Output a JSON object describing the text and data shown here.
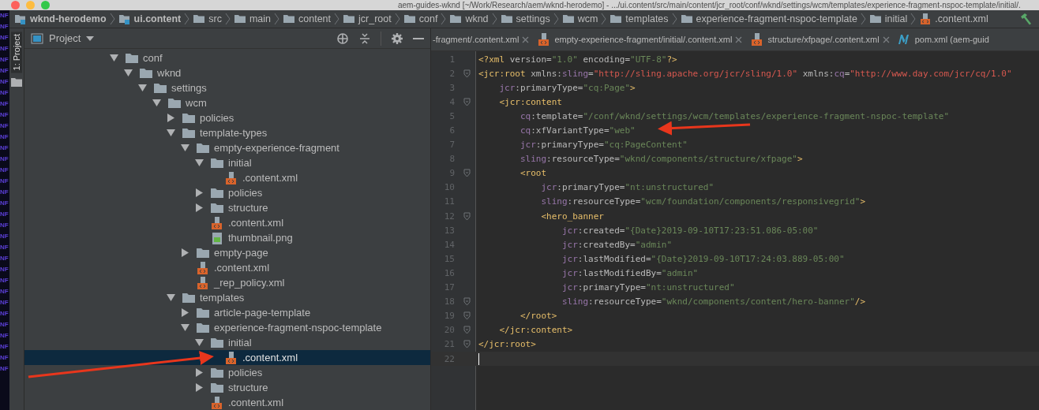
{
  "window": {
    "title": "aem-guides-wknd [~/Work/Research/aem/wknd-herodemo] - .../ui.content/src/main/content/jcr_root/conf/wknd/settings/wcm/templates/experience-fragment-nspoc-template/initial/."
  },
  "background_text": [
    "NF",
    "NF",
    "NF",
    "NF",
    "NF",
    "NF",
    "NF",
    "NF",
    "NF",
    "NF",
    "NF",
    "NF",
    "NF",
    "NF",
    "NF",
    "NF",
    "NF",
    "NF",
    "NF",
    "NF",
    "NF",
    "NF",
    "NF",
    "NF",
    "NF",
    "NF",
    "NF",
    "NF",
    "NF",
    "NF",
    "NF",
    "NF",
    "NF"
  ],
  "breadcrumbs": [
    {
      "label": "wknd-herodemo",
      "kind": "module"
    },
    {
      "label": "ui.content",
      "kind": "module"
    },
    {
      "label": "src",
      "kind": "folder"
    },
    {
      "label": "main",
      "kind": "folder"
    },
    {
      "label": "content",
      "kind": "folder"
    },
    {
      "label": "jcr_root",
      "kind": "folder"
    },
    {
      "label": "conf",
      "kind": "folder"
    },
    {
      "label": "wknd",
      "kind": "folder"
    },
    {
      "label": "settings",
      "kind": "folder"
    },
    {
      "label": "wcm",
      "kind": "folder"
    },
    {
      "label": "templates",
      "kind": "folder"
    },
    {
      "label": "experience-fragment-nspoc-template",
      "kind": "folder"
    },
    {
      "label": "initial",
      "kind": "folder"
    },
    {
      "label": ".content.xml",
      "kind": "xml"
    }
  ],
  "tool_stripe": {
    "label": "1: Project"
  },
  "project_panel": {
    "title": "Project"
  },
  "tree": [
    {
      "label": "conf",
      "kind": "folder",
      "expanded": true,
      "selected": false,
      "children": [
        {
          "label": "wknd",
          "kind": "folder",
          "expanded": true,
          "selected": false,
          "children": [
            {
              "label": "settings",
              "kind": "folder",
              "expanded": true,
              "selected": false,
              "children": [
                {
                  "label": "wcm",
                  "kind": "folder",
                  "expanded": true,
                  "selected": false,
                  "children": [
                    {
                      "label": "policies",
                      "kind": "folder",
                      "expanded": false,
                      "selected": false
                    },
                    {
                      "label": "template-types",
                      "kind": "folder",
                      "expanded": true,
                      "selected": false,
                      "children": [
                        {
                          "label": "empty-experience-fragment",
                          "kind": "folder",
                          "expanded": true,
                          "selected": false,
                          "children": [
                            {
                              "label": "initial",
                              "kind": "folder",
                              "expanded": true,
                              "selected": false,
                              "children": [
                                {
                                  "label": ".content.xml",
                                  "kind": "xml",
                                  "selected": false
                                }
                              ]
                            },
                            {
                              "label": "policies",
                              "kind": "folder",
                              "expanded": false,
                              "selected": false
                            },
                            {
                              "label": "structure",
                              "kind": "folder",
                              "expanded": false,
                              "selected": false
                            },
                            {
                              "label": ".content.xml",
                              "kind": "xml",
                              "selected": false
                            },
                            {
                              "label": "thumbnail.png",
                              "kind": "image",
                              "selected": false
                            }
                          ]
                        },
                        {
                          "label": "empty-page",
                          "kind": "folder",
                          "expanded": false,
                          "selected": false
                        },
                        {
                          "label": ".content.xml",
                          "kind": "xml",
                          "selected": false
                        },
                        {
                          "label": "_rep_policy.xml",
                          "kind": "xml",
                          "selected": false
                        }
                      ]
                    },
                    {
                      "label": "templates",
                      "kind": "folder",
                      "expanded": true,
                      "selected": false,
                      "children": [
                        {
                          "label": "article-page-template",
                          "kind": "folder",
                          "expanded": false,
                          "selected": false
                        },
                        {
                          "label": "experience-fragment-nspoc-template",
                          "kind": "folder",
                          "expanded": true,
                          "selected": false,
                          "children": [
                            {
                              "label": "initial",
                              "kind": "folder",
                              "expanded": true,
                              "selected": false,
                              "children": [
                                {
                                  "label": ".content.xml",
                                  "kind": "xml",
                                  "selected": true
                                }
                              ]
                            },
                            {
                              "label": "policies",
                              "kind": "folder",
                              "expanded": false,
                              "selected": false
                            },
                            {
                              "label": "structure",
                              "kind": "folder",
                              "expanded": false,
                              "selected": false
                            },
                            {
                              "label": ".content.xml",
                              "kind": "xml",
                              "selected": false
                            }
                          ]
                        }
                      ]
                    }
                  ]
                }
              ]
            }
          ]
        }
      ]
    }
  ],
  "tabs": [
    {
      "label": "-fragment/.content.xml",
      "kind": "none",
      "selected": false
    },
    {
      "label": "empty-experience-fragment/initial/.content.xml",
      "kind": "xml",
      "selected": false
    },
    {
      "label": "structure/xfpage/.content.xml",
      "kind": "xml",
      "selected": false
    },
    {
      "label": "pom.xml (aem-guid",
      "kind": "maven",
      "selected": false
    }
  ],
  "editor": {
    "lines": [
      {
        "number": "1",
        "fold": false,
        "current": false,
        "segments": [
          {
            "text": "<?xml ",
            "kind": "tag"
          },
          {
            "text": "version=",
            "kind": "attr"
          },
          {
            "text": "\"1.0\"",
            "kind": "str"
          },
          {
            "text": " encoding=",
            "kind": "attr"
          },
          {
            "text": "\"UTF-8\"",
            "kind": "str"
          },
          {
            "text": "?>",
            "kind": "tag"
          }
        ]
      },
      {
        "number": "2",
        "fold": true,
        "current": false,
        "segments": [
          {
            "text": "<jcr:root ",
            "kind": "tag"
          },
          {
            "text": "xmlns:",
            "kind": "attr"
          },
          {
            "text": "sling",
            "kind": "ns"
          },
          {
            "text": "=",
            "kind": "attr"
          },
          {
            "text": "\"http://sling.apache.org/jcr/sling/1.0\"",
            "kind": "url"
          },
          {
            "text": " xmlns:",
            "kind": "attr"
          },
          {
            "text": "cq",
            "kind": "ns"
          },
          {
            "text": "=",
            "kind": "attr"
          },
          {
            "text": "\"http://www.day.com/jcr/cq/1.0\"",
            "kind": "url"
          }
        ]
      },
      {
        "number": "3",
        "fold": false,
        "current": false,
        "segments": [
          {
            "text": "    jcr",
            "kind": "ns"
          },
          {
            "text": ":primaryType=",
            "kind": "attr"
          },
          {
            "text": "\"cq:Page\"",
            "kind": "str"
          },
          {
            "text": ">",
            "kind": "tag"
          }
        ]
      },
      {
        "number": "4",
        "fold": true,
        "current": false,
        "segments": [
          {
            "text": "    <jcr:content",
            "kind": "tag"
          }
        ]
      },
      {
        "number": "5",
        "fold": false,
        "current": false,
        "segments": [
          {
            "text": "        cq",
            "kind": "ns"
          },
          {
            "text": ":template=",
            "kind": "attr"
          },
          {
            "text": "\"/conf/wknd/settings/wcm/templates/experience-fragment-nspoc-template\"",
            "kind": "str"
          }
        ]
      },
      {
        "number": "6",
        "fold": false,
        "current": false,
        "segments": [
          {
            "text": "        cq",
            "kind": "ns"
          },
          {
            "text": ":xfVariantType=",
            "kind": "attr"
          },
          {
            "text": "\"web\"",
            "kind": "str"
          }
        ]
      },
      {
        "number": "7",
        "fold": false,
        "current": false,
        "segments": [
          {
            "text": "        jcr",
            "kind": "ns"
          },
          {
            "text": ":primaryType=",
            "kind": "attr"
          },
          {
            "text": "\"cq:PageContent\"",
            "kind": "str"
          }
        ]
      },
      {
        "number": "8",
        "fold": false,
        "current": false,
        "segments": [
          {
            "text": "        sling",
            "kind": "ns"
          },
          {
            "text": ":resourceType=",
            "kind": "attr"
          },
          {
            "text": "\"wknd/components/structure/xfpage\"",
            "kind": "str"
          },
          {
            "text": ">",
            "kind": "tag"
          }
        ]
      },
      {
        "number": "9",
        "fold": true,
        "current": false,
        "segments": [
          {
            "text": "        <root",
            "kind": "tag"
          }
        ]
      },
      {
        "number": "10",
        "fold": false,
        "current": false,
        "segments": [
          {
            "text": "            jcr",
            "kind": "ns"
          },
          {
            "text": ":primaryType=",
            "kind": "attr"
          },
          {
            "text": "\"nt:unstructured\"",
            "kind": "str"
          }
        ]
      },
      {
        "number": "11",
        "fold": false,
        "current": false,
        "segments": [
          {
            "text": "            sling",
            "kind": "ns"
          },
          {
            "text": ":resourceType=",
            "kind": "attr"
          },
          {
            "text": "\"wcm/foundation/components/responsivegrid\"",
            "kind": "str"
          },
          {
            "text": ">",
            "kind": "tag"
          }
        ]
      },
      {
        "number": "12",
        "fold": true,
        "current": false,
        "segments": [
          {
            "text": "            <hero_banner",
            "kind": "tag"
          }
        ]
      },
      {
        "number": "13",
        "fold": false,
        "current": false,
        "segments": [
          {
            "text": "                jcr",
            "kind": "ns"
          },
          {
            "text": ":created=",
            "kind": "attr"
          },
          {
            "text": "\"{Date}2019-09-10T17:23:51.086-05:00\"",
            "kind": "str"
          }
        ]
      },
      {
        "number": "14",
        "fold": false,
        "current": false,
        "segments": [
          {
            "text": "                jcr",
            "kind": "ns"
          },
          {
            "text": ":createdBy=",
            "kind": "attr"
          },
          {
            "text": "\"admin\"",
            "kind": "str"
          }
        ]
      },
      {
        "number": "15",
        "fold": false,
        "current": false,
        "segments": [
          {
            "text": "                jcr",
            "kind": "ns"
          },
          {
            "text": ":lastModified=",
            "kind": "attr"
          },
          {
            "text": "\"{Date}2019-09-10T17:24:03.889-05:00\"",
            "kind": "str"
          }
        ]
      },
      {
        "number": "16",
        "fold": false,
        "current": false,
        "segments": [
          {
            "text": "                jcr",
            "kind": "ns"
          },
          {
            "text": ":lastModifiedBy=",
            "kind": "attr"
          },
          {
            "text": "\"admin\"",
            "kind": "str"
          }
        ]
      },
      {
        "number": "17",
        "fold": false,
        "current": false,
        "segments": [
          {
            "text": "                jcr",
            "kind": "ns"
          },
          {
            "text": ":primaryType=",
            "kind": "attr"
          },
          {
            "text": "\"nt:unstructured\"",
            "kind": "str"
          }
        ]
      },
      {
        "number": "18",
        "fold": true,
        "current": false,
        "segments": [
          {
            "text": "                sling",
            "kind": "ns"
          },
          {
            "text": ":resourceType=",
            "kind": "attr"
          },
          {
            "text": "\"wknd/components/content/hero-banner\"",
            "kind": "str"
          },
          {
            "text": "/>",
            "kind": "tag"
          }
        ]
      },
      {
        "number": "19",
        "fold": true,
        "current": false,
        "segments": [
          {
            "text": "        </root>",
            "kind": "tag"
          }
        ]
      },
      {
        "number": "20",
        "fold": true,
        "current": false,
        "segments": [
          {
            "text": "    </jcr:content>",
            "kind": "tag"
          }
        ]
      },
      {
        "number": "21",
        "fold": true,
        "current": false,
        "segments": [
          {
            "text": "</jcr:root>",
            "kind": "tag"
          }
        ]
      },
      {
        "number": "22",
        "fold": false,
        "current": true
      }
    ]
  }
}
